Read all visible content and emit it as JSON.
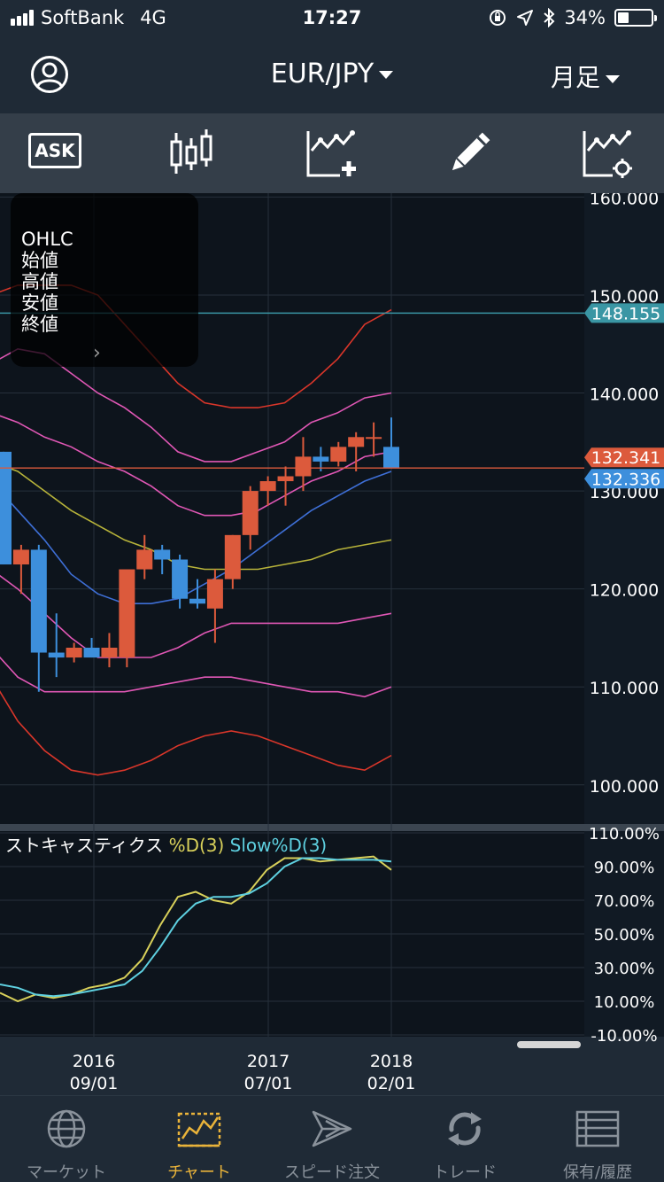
{
  "status_bar": {
    "carrier": "SoftBank",
    "network": "4G",
    "time": "17:27",
    "battery_percent": "34%",
    "battery_level": 0.34
  },
  "header": {
    "pair": "EUR/JPY",
    "period": "月足"
  },
  "toolbar": {
    "ask_label": "ASK"
  },
  "ohlc_panel": {
    "title": "OHLC",
    "open": "始値",
    "high": "高値",
    "low": "安値",
    "close": "終値"
  },
  "stoch_legend": {
    "name": "ストキャスティクス",
    "d_label": "%D(3)",
    "slowd_label": "Slow%D(3)"
  },
  "colors": {
    "up": "#dc5a3c",
    "down": "#3d8fdc",
    "bb_outer": "#d9362a",
    "bb_mid": "#e057b5",
    "ma": "#b7b33a",
    "ema": "#3e6fd6",
    "d_line": "#d8d05a",
    "slowd_line": "#5ed0e0",
    "accent": "#e9b33a",
    "ask_price_bg": "#dc5a3c",
    "bid_price_bg": "#3d8fdc",
    "line_148_bg": "#3a96a4"
  },
  "chart_data": {
    "type": "candlestick",
    "price_axis_ticks": [
      "160.000",
      "150.000",
      "140.000",
      "130.000",
      "120.000",
      "110.000",
      "100.000"
    ],
    "price_ylim": [
      96.0,
      160.4
    ],
    "price_labels": [
      {
        "value": 148.155,
        "text": "148.155"
      },
      {
        "value": 132.341,
        "text": "132.341"
      },
      {
        "value": 132.336,
        "text": "132.336"
      }
    ],
    "x_ticks": [
      {
        "line1": "2016",
        "line2": "09/01"
      },
      {
        "line1": "2017",
        "line2": "07/01"
      },
      {
        "line1": "2018",
        "line2": "02/01"
      }
    ],
    "candles": [
      {
        "o": 134.0,
        "h": 134.0,
        "l": 122.5,
        "c": 122.5
      },
      {
        "o": 122.5,
        "h": 124.5,
        "l": 119.5,
        "c": 124.0
      },
      {
        "o": 124.0,
        "h": 124.5,
        "l": 109.5,
        "c": 113.5
      },
      {
        "o": 113.5,
        "h": 117.5,
        "l": 111.0,
        "c": 113.0
      },
      {
        "o": 113.0,
        "h": 114.5,
        "l": 112.5,
        "c": 114.0
      },
      {
        "o": 114.0,
        "h": 115.0,
        "l": 113.0,
        "c": 113.0
      },
      {
        "o": 113.0,
        "h": 115.5,
        "l": 112.0,
        "c": 114.0
      },
      {
        "o": 113.0,
        "h": 116.5,
        "l": 112.0,
        "c": 122.0
      },
      {
        "o": 122.0,
        "h": 125.5,
        "l": 121.0,
        "c": 124.0
      },
      {
        "o": 124.0,
        "h": 124.5,
        "l": 121.5,
        "c": 123.0
      },
      {
        "o": 123.0,
        "h": 123.5,
        "l": 118.0,
        "c": 119.0
      },
      {
        "o": 119.0,
        "h": 121.0,
        "l": 118.0,
        "c": 118.5
      },
      {
        "o": 118.0,
        "h": 122.0,
        "l": 114.5,
        "c": 121.0
      },
      {
        "o": 121.0,
        "h": 125.5,
        "l": 120.0,
        "c": 125.5
      },
      {
        "o": 125.5,
        "h": 130.5,
        "l": 124.0,
        "c": 130.0
      },
      {
        "o": 130.0,
        "h": 131.5,
        "l": 128.5,
        "c": 131.0
      },
      {
        "o": 131.0,
        "h": 132.5,
        "l": 128.5,
        "c": 131.5
      },
      {
        "o": 131.5,
        "h": 135.5,
        "l": 130.0,
        "c": 133.5
      },
      {
        "o": 133.5,
        "h": 134.5,
        "l": 132.0,
        "c": 133.0
      },
      {
        "o": 133.0,
        "h": 135.0,
        "l": 132.5,
        "c": 134.5
      },
      {
        "o": 134.5,
        "h": 136.0,
        "l": 132.0,
        "c": 135.5
      },
      {
        "o": 135.5,
        "h": 137.0,
        "l": 133.5,
        "c": 135.5
      },
      {
        "o": 134.5,
        "h": 137.5,
        "l": 132.3,
        "c": 132.3
      }
    ],
    "bb_upper2": [
      150.0,
      151.0,
      151.0,
      151.0,
      150.0,
      147.0,
      144.0,
      141.0,
      139.0,
      138.5,
      138.5,
      139.0,
      141.0,
      143.5,
      147.0,
      148.5
    ],
    "bb_upper1": [
      143.0,
      144.5,
      144.0,
      142.0,
      140.0,
      138.5,
      136.5,
      134.0,
      133.0,
      133.0,
      134.0,
      135.0,
      137.0,
      138.0,
      139.5,
      140.0
    ],
    "bb_mid_upper": [
      138.0,
      137.0,
      135.5,
      134.5,
      133.0,
      132.0,
      130.5,
      128.5,
      127.5,
      127.5,
      128.0,
      129.5,
      131.0,
      132.0,
      133.5,
      134.0
    ],
    "ma_line": [
      133.0,
      132.0,
      130.0,
      128.0,
      126.5,
      125.0,
      124.0,
      122.5,
      122.0,
      122.0,
      122.0,
      122.5,
      123.0,
      124.0,
      124.5,
      125.0
    ],
    "ema_line": [
      131.0,
      128.0,
      125.0,
      121.5,
      119.5,
      118.5,
      118.5,
      119.0,
      120.5,
      122.0,
      124.0,
      126.0,
      128.0,
      129.5,
      131.0,
      132.0
    ],
    "bb_lower1": [
      122.0,
      120.0,
      117.5,
      115.0,
      113.0,
      113.0,
      113.0,
      114.0,
      115.5,
      116.5,
      116.5,
      116.5,
      116.5,
      116.5,
      117.0,
      117.5
    ],
    "bb_lower2": [
      114.0,
      111.0,
      109.5,
      109.5,
      109.5,
      109.5,
      110.0,
      110.5,
      111.0,
      111.0,
      110.5,
      110.0,
      109.5,
      109.5,
      109.0,
      110.0
    ],
    "bb_lower3": [
      111.0,
      106.5,
      103.5,
      101.5,
      101.0,
      101.5,
      102.5,
      104.0,
      105.0,
      105.5,
      105.0,
      104.0,
      103.0,
      102.0,
      101.5,
      103.0
    ],
    "stoch_axis_ticks": [
      "110.00%",
      "90.00%",
      "70.00%",
      "50.00%",
      "30.00%",
      "10.00%",
      "-10.00%"
    ],
    "stoch_ylim": [
      -10,
      110
    ],
    "stoch_d": [
      15,
      10,
      14,
      12,
      14,
      18,
      20,
      24,
      35,
      55,
      72,
      75,
      70,
      68,
      75,
      88,
      95,
      95,
      93,
      94,
      95,
      96,
      88
    ],
    "stoch_slowd": [
      20,
      18,
      14,
      13,
      14,
      16,
      18,
      20,
      28,
      42,
      58,
      68,
      72,
      72,
      74,
      80,
      90,
      95,
      95,
      94,
      94,
      94,
      93
    ]
  },
  "tabs": [
    {
      "label": "マーケット",
      "icon": "globe-icon"
    },
    {
      "label": "チャート",
      "icon": "chart-icon"
    },
    {
      "label": "スピード注文",
      "icon": "speed-order-icon"
    },
    {
      "label": "トレード",
      "icon": "trade-icon"
    },
    {
      "label": "保有/履歴",
      "icon": "history-icon"
    }
  ]
}
